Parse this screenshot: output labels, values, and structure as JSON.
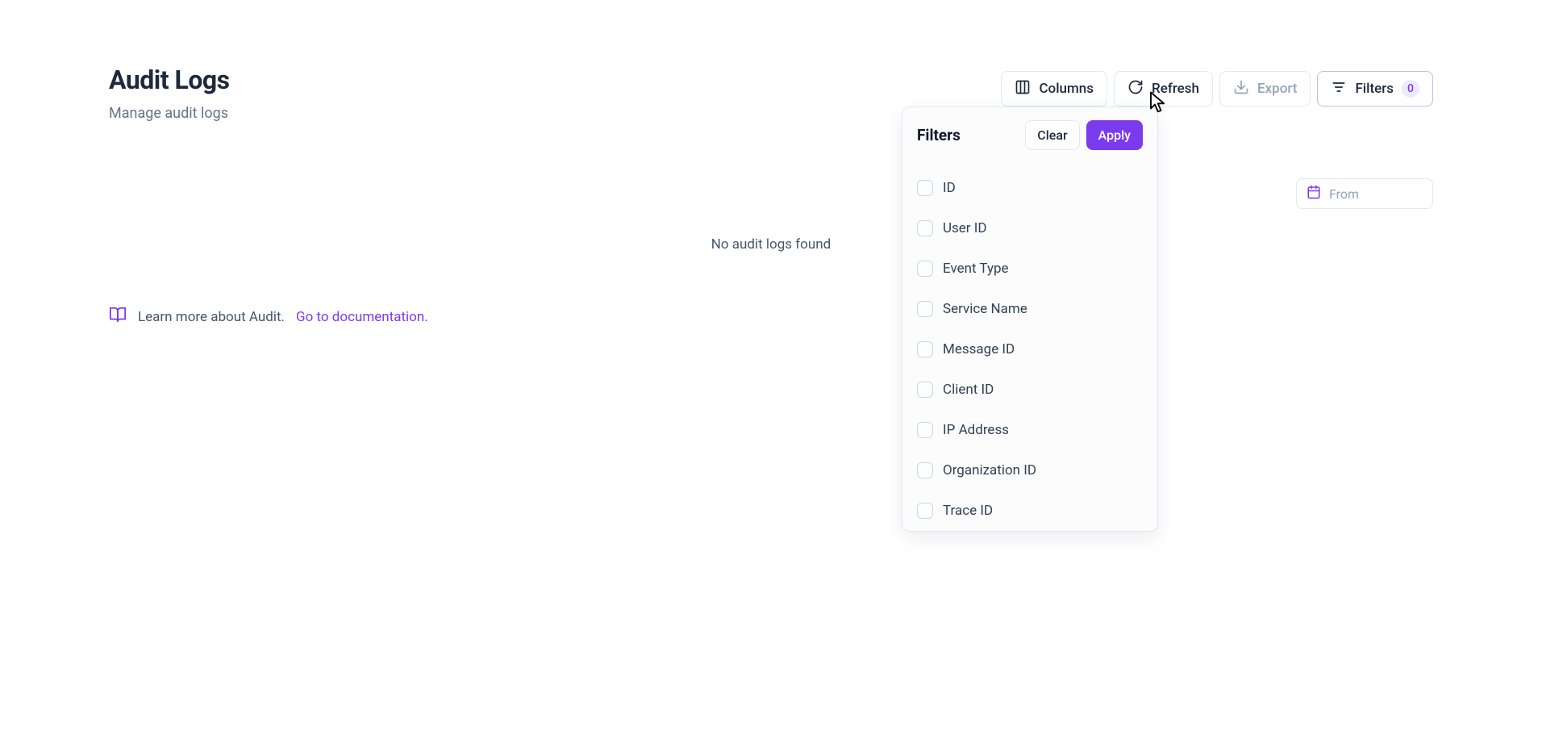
{
  "header": {
    "title": "Audit Logs",
    "subtitle": "Manage audit logs"
  },
  "toolbar": {
    "columns_label": "Columns",
    "refresh_label": "Refresh",
    "export_label": "Export",
    "filters_label": "Filters",
    "filters_badge": "0"
  },
  "date_from": {
    "placeholder": "From"
  },
  "empty_state": "No audit logs found",
  "learn_more": {
    "text": "Learn more about Audit.",
    "link_text": "Go to documentation."
  },
  "filters_popover": {
    "title": "Filters",
    "clear_label": "Clear",
    "apply_label": "Apply",
    "items": [
      {
        "label": "ID"
      },
      {
        "label": "User ID"
      },
      {
        "label": "Event Type"
      },
      {
        "label": "Service Name"
      },
      {
        "label": "Message ID"
      },
      {
        "label": "Client ID"
      },
      {
        "label": "IP Address"
      },
      {
        "label": "Organization ID"
      },
      {
        "label": "Trace ID"
      }
    ]
  }
}
